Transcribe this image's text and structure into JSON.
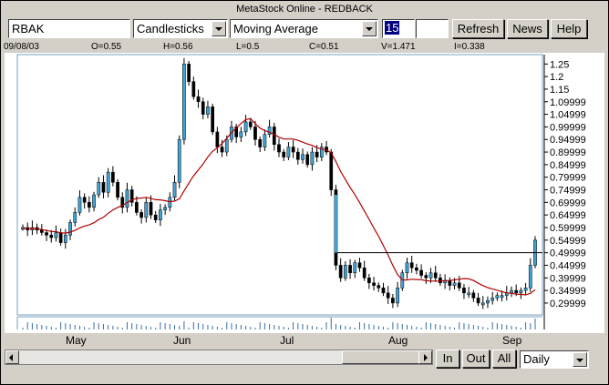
{
  "window": {
    "title": "MetaStock Online - REDBACK"
  },
  "toolbar": {
    "symbol": "RBAK",
    "chart_type": "Candlesticks",
    "indicator": "Moving Average",
    "period": "15",
    "period2": "",
    "refresh_label": "Refresh",
    "news_label": "News",
    "help_label": "Help"
  },
  "ohlc": {
    "date": "09/08/03",
    "open": "O=0.55",
    "high": "H=0.56",
    "low": "L=0.5",
    "close": "C=0.51",
    "volume": "V=1.471",
    "interest": "I=0.338"
  },
  "bottom": {
    "in_label": "In",
    "out_label": "Out",
    "all_label": "All",
    "interval": "Daily"
  },
  "colors": {
    "up": "#3fa3d6",
    "ma": "#b00000",
    "ref": "#000000"
  },
  "chart_data": {
    "type": "candlestick",
    "x_labels": [
      "May",
      "Jun",
      "Jul",
      "Aug",
      "Sep"
    ],
    "y_ticks": [
      "1.25",
      "1.2",
      "1.15",
      "1.09999",
      "1.04999",
      "0.99999",
      "0.94999",
      "0.89999",
      "0.84999",
      "0.79999",
      "0.74999",
      "0.69999",
      "0.64999",
      "0.59999",
      "0.54999",
      "0.49999",
      "0.44999",
      "0.39999",
      "0.34999",
      "0.29999"
    ],
    "ylim": [
      0.26,
      1.28
    ],
    "reference_level": 0.5,
    "moving_average_period": 15,
    "closes": [
      0.6,
      0.59,
      0.6,
      0.59,
      0.58,
      0.57,
      0.56,
      0.58,
      0.54,
      0.57,
      0.62,
      0.66,
      0.72,
      0.7,
      0.68,
      0.73,
      0.78,
      0.74,
      0.82,
      0.78,
      0.72,
      0.68,
      0.75,
      0.7,
      0.66,
      0.64,
      0.7,
      0.65,
      0.63,
      0.67,
      0.68,
      0.72,
      0.78,
      0.95,
      1.25,
      1.18,
      1.12,
      1.1,
      1.05,
      1.08,
      0.98,
      0.92,
      0.9,
      0.95,
      1.0,
      0.96,
      0.98,
      1.02,
      1.0,
      0.95,
      0.92,
      0.97,
      1.0,
      0.93,
      0.9,
      0.88,
      0.92,
      0.9,
      0.87,
      0.89,
      0.85,
      0.9,
      0.88,
      0.92,
      0.9,
      0.75,
      0.45,
      0.4,
      0.45,
      0.42,
      0.46,
      0.44,
      0.4,
      0.38,
      0.37,
      0.36,
      0.34,
      0.32,
      0.3,
      0.36,
      0.42,
      0.46,
      0.44,
      0.43,
      0.41,
      0.4,
      0.42,
      0.4,
      0.38,
      0.39,
      0.37,
      0.38,
      0.36,
      0.34,
      0.34,
      0.32,
      0.3,
      0.3,
      0.31,
      0.32,
      0.33,
      0.33,
      0.34,
      0.35,
      0.34,
      0.35,
      0.36,
      0.45,
      0.55
    ]
  }
}
